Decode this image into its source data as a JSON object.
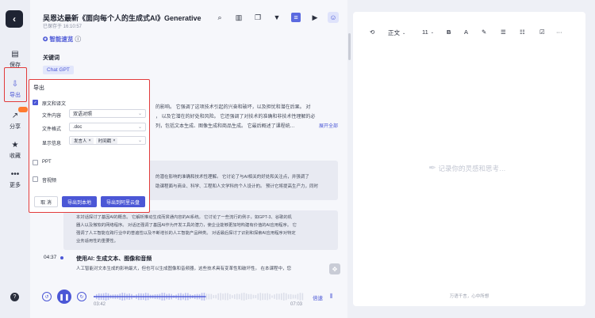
{
  "rail": {
    "save": "保存",
    "export": "导出",
    "share": "分享",
    "collect": "收藏",
    "more": "更多"
  },
  "header": {
    "title": "吴恩达最新《面向每个人的生成式AI》Generative…",
    "saved": "已保存于 16:10:57"
  },
  "smart": "智能速览",
  "keywords": {
    "heading": "关键词",
    "tags": [
      "Chat GPT"
    ]
  },
  "summary": {
    "line1": "的影响。 它强调了这项技术引起的兴奋和破坏，以及担忧和潜在后果。 对",
    "line2": "， 以及它潜在的好处和风险。 它还强调了对技术的准确和非技术性理解的必",
    "line3": "列，包括文本生成、图像生成和商品生成。 它最后概述了课程统…",
    "expand": "展开全部"
  },
  "card1": {
    "l1": "的潜在影响的准确和技术性理解。 它讨论了与AI相关的好处和关注点，并强调了",
    "l2": "助课程面与商业、科学、工程和人文学科的个人设计的。 预计它将提高生产力，同时"
  },
  "card2": {
    "l1": "本対话探讨了基因AI的概念。 它解析推动生成而贯通内容的AI系统。 它讨论了一些流行的例子，如GPT-3、谷歌的机",
    "l2": "器人以及微软的网络程序。 对话还强调了基因AI作为开发工具的潜力，使企业能够更加地构建有价值的AI应用程序。 它",
    "l3": "强调了人工智能在跨行业中的普遍性以及不断增长的人工智能产品种类。 对话最后探讨了识别和探索AI应用程序对特定",
    "l4": "业务适用性的重要性。"
  },
  "section": {
    "time": "04:37",
    "title": "使用AI: 生成文本、图像和音频",
    "text": "人工智能对文本生成的影响最大，但也可以生成图像和音频器，这些技术具有变革性和破坏性。 在本课程中，您"
  },
  "player": {
    "current": "03:42",
    "total": "07:03",
    "speed": "倍速",
    "progress": 0.53
  },
  "editor": {
    "style": "正文",
    "size": "11",
    "placeholder": "记录你的灵感和思考…",
    "footer": "万语千言，心中所想"
  },
  "dialog": {
    "title": "导出",
    "opt_source": "原文和译文",
    "content_label": "文件内容",
    "content_value": "双语对照",
    "format_label": "文件格式",
    "format_value": ".doc",
    "display_label": "显示信息",
    "chip1": "发言人",
    "chip2": "时间戳",
    "opt_ppt": "PPT",
    "opt_audio": "音视频",
    "cancel": "取 消",
    "export_local": "导出到本地",
    "export_cloud": "导出到阿里云盘"
  },
  "colors": {
    "accent": "#4b57d6",
    "highlight": "#e23b3b"
  }
}
